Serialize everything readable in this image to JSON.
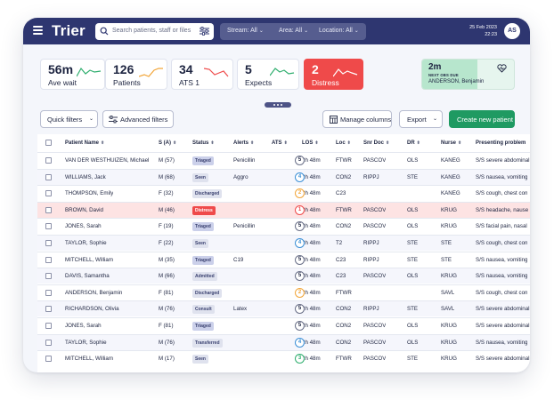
{
  "app": {
    "title": "Trier"
  },
  "search": {
    "placeholder": "Search patients, staff or files"
  },
  "filters": [
    {
      "label": "Stream: All"
    },
    {
      "label": "Area: All"
    },
    {
      "label": "Location: All"
    }
  ],
  "header": {
    "date": "25 Feb 2023",
    "time": "22:23",
    "user_initials": "AS"
  },
  "stats": [
    {
      "value": "56m",
      "label": "Ave wait",
      "color": "#2fae6e"
    },
    {
      "value": "126",
      "label": "Patients",
      "color": "#f2a63a"
    },
    {
      "value": "34",
      "label": "ATS 1",
      "color": "#ef4a4a"
    },
    {
      "value": "5",
      "label": "Expects",
      "color": "#2fae6e"
    },
    {
      "value": "2",
      "label": "Distress",
      "color": "#ffffff"
    }
  ],
  "next_obs": {
    "value": "2m",
    "label": "NEXT OBS DUE",
    "patient": "ANDERSON, Benjamin",
    "progress": 0.6
  },
  "toolbar": {
    "quick_filters": "Quick filters",
    "advanced_filters": "Advanced filters",
    "manage_columns": "Manage columns",
    "export": "Export",
    "create": "Create new patient"
  },
  "columns": [
    "Patient Name",
    "S (A)",
    "Status",
    "Alerts",
    "ATS",
    "LOS",
    "Loc",
    "Snr Doc",
    "DR",
    "Nurse",
    "Presenting problem"
  ],
  "rows": [
    {
      "name": "VAN DER WESTHUIZEN, Michael",
      "sa": "M (57)",
      "status": "Triaged",
      "alerts": "Penicillin",
      "ats": "5",
      "los": "2h 48m",
      "loc": "FTWR",
      "snr": "PASCOV",
      "dr": "OLS",
      "nurse": "KANEG",
      "problem": "S/S severe abdominal"
    },
    {
      "name": "WILLIAMS, Jack",
      "sa": "M (68)",
      "status": "Seen",
      "alerts": "Aggro",
      "ats": "4",
      "los": "2h 48m",
      "loc": "CON2",
      "snr": "RIPPJ",
      "dr": "STE",
      "nurse": "KANEG",
      "problem": "S/S nausea, vomiting"
    },
    {
      "name": "THOMPSON, Emily",
      "sa": "F (32)",
      "status": "Discharged",
      "alerts": "",
      "ats": "2",
      "los": "2h 48m",
      "loc": "C23",
      "snr": "",
      "dr": "",
      "nurse": "KANEG",
      "problem": "S/S cough, chest con"
    },
    {
      "name": "BROWN, David",
      "sa": "M (46)",
      "status": "Distress",
      "alerts": "",
      "ats": "1",
      "los": "2h 48m",
      "loc": "FTWR",
      "snr": "PASCOV",
      "dr": "OLS",
      "nurse": "KRUG",
      "problem": "S/S headache, nause"
    },
    {
      "name": "JONES, Sarah",
      "sa": "F (19)",
      "status": "Triaged",
      "alerts": "Penicillin",
      "ats": "5",
      "los": "2h 48m",
      "loc": "CON2",
      "snr": "PASCOV",
      "dr": "OLS",
      "nurse": "KRUG",
      "problem": "S/S facial pain, nasal"
    },
    {
      "name": "TAYLOR, Sophie",
      "sa": "F (22)",
      "status": "Seen",
      "alerts": "",
      "ats": "4",
      "los": "2h 48m",
      "loc": "T2",
      "snr": "RIPPJ",
      "dr": "STE",
      "nurse": "STE",
      "problem": "S/S cough, chest con"
    },
    {
      "name": "MITCHELL, William",
      "sa": "M (35)",
      "status": "Triaged",
      "alerts": "C19",
      "ats": "5",
      "los": "2h 48m",
      "loc": "C23",
      "snr": "RIPPJ",
      "dr": "STE",
      "nurse": "STE",
      "problem": "S/S nausea, vomiting"
    },
    {
      "name": "DAVIS, Samantha",
      "sa": "M (66)",
      "status": "Admitted",
      "alerts": "",
      "ats": "5",
      "los": "2h 48m",
      "loc": "C23",
      "snr": "PASCOV",
      "dr": "OLS",
      "nurse": "KRUG",
      "problem": "S/S nausea, vomiting"
    },
    {
      "name": "ANDERSON, Benjamin",
      "sa": "F (81)",
      "status": "Discharged",
      "alerts": "",
      "ats": "2",
      "los": "2h 48m",
      "loc": "FTWR",
      "snr": "",
      "dr": "",
      "nurse": "SAVL",
      "problem": "S/S cough, chest con"
    },
    {
      "name": "RICHARDSON, Olivia",
      "sa": "M (76)",
      "status": "Consult",
      "alerts": "Latex",
      "ats": "5",
      "los": "2h 48m",
      "loc": "CON2",
      "snr": "RIPPJ",
      "dr": "STE",
      "nurse": "SAVL",
      "problem": "S/S severe abdominal"
    },
    {
      "name": "JONES, Sarah",
      "sa": "F (81)",
      "status": "Triaged",
      "alerts": "",
      "ats": "5",
      "los": "2h 48m",
      "loc": "CON2",
      "snr": "PASCOV",
      "dr": "OLS",
      "nurse": "KRUG",
      "problem": "S/S severe abdominal"
    },
    {
      "name": "TAYLOR, Sophie",
      "sa": "M (76)",
      "status": "Transferred",
      "alerts": "",
      "ats": "4",
      "los": "2h 48m",
      "loc": "CON2",
      "snr": "PASCOV",
      "dr": "OLS",
      "nurse": "KRUG",
      "problem": "S/S nausea, vomiting"
    },
    {
      "name": "MITCHELL, William",
      "sa": "M (17)",
      "status": "Seen",
      "alerts": "",
      "ats": "3",
      "los": "2h 48m",
      "loc": "FTWR",
      "snr": "PASCOV",
      "dr": "STE",
      "nurse": "KRUG",
      "problem": "S/S severe abdominal"
    }
  ],
  "ats_colors": {
    "1": "#ef4a4a",
    "2": "#f2a63a",
    "3": "#2fae6e",
    "4": "#3b8fd6",
    "5": "#6a7088"
  }
}
